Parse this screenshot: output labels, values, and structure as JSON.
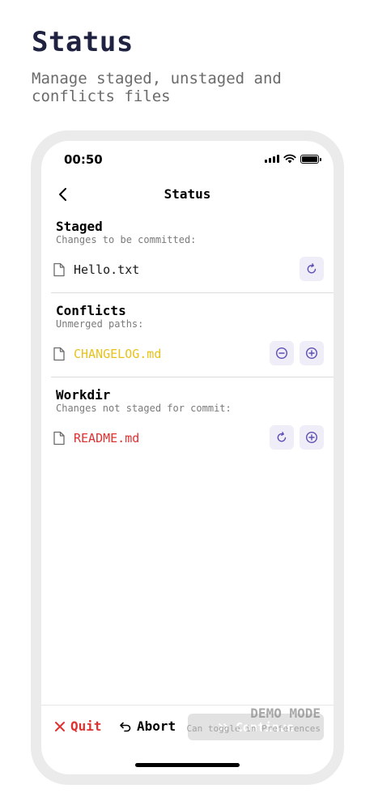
{
  "hero": {
    "title": "Status",
    "subtitle": "Manage staged, unstaged and conflicts files"
  },
  "status_bar": {
    "time": "00:50",
    "icons": [
      "signal-icon",
      "wifi-icon",
      "battery-icon"
    ]
  },
  "nav": {
    "title": "Status",
    "back_icon": "chevron-left-icon"
  },
  "sections": [
    {
      "title": "Staged",
      "subtitle": "Changes to be committed:",
      "files": [
        {
          "name": "Hello.txt",
          "color": "#1a1a1a",
          "actions": [
            "revert-icon"
          ]
        }
      ]
    },
    {
      "title": "Conflicts",
      "subtitle": "Unmerged paths:",
      "files": [
        {
          "name": "CHANGELOG.md",
          "color": "#e8c21a",
          "actions": [
            "minus-circle-icon",
            "plus-circle-icon"
          ]
        }
      ]
    },
    {
      "title": "Workdir",
      "subtitle": "Changes not staged for commit:",
      "files": [
        {
          "name": "README.md",
          "color": "#e03131",
          "actions": [
            "revert-icon",
            "plus-circle-icon"
          ]
        }
      ]
    }
  ],
  "bottom": {
    "quit_label": "Quit",
    "abort_label": "Abort",
    "continue_label": "Continue",
    "demo_label": "DEMO MODE",
    "demo_hint": "Can toggle in Preferences"
  },
  "colors": {
    "accent": "#5b4fb5",
    "button_bg": "#efeef8",
    "danger": "#e03131",
    "warning": "#e8c21a"
  }
}
